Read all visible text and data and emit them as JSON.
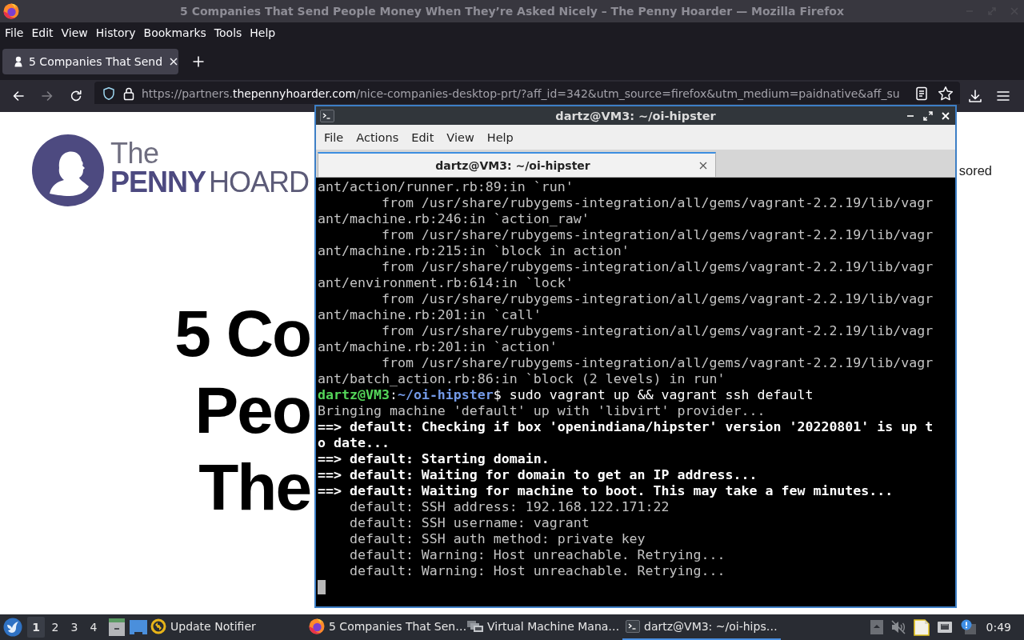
{
  "browser": {
    "title": "5 Companies That Send People Money When They’re Asked Nicely – The Penny Hoarder — Mozilla Firefox",
    "menu": [
      "File",
      "Edit",
      "View",
      "History",
      "Bookmarks",
      "Tools",
      "Help"
    ],
    "tabs": [
      {
        "label": "5 Companies That Send",
        "selected": true
      }
    ],
    "nav_buttons": [
      {
        "kind": "back",
        "disabled": false
      },
      {
        "kind": "forward",
        "disabled": true
      },
      {
        "kind": "reload",
        "disabled": false
      }
    ],
    "url": {
      "prefix": "https://partners.",
      "domain": "thepennyhoarder.com",
      "path": "/nice-companies-desktop-prt/?aff_id=342&utm_source=firefox&utm_medium=paidnative&aff_su"
    }
  },
  "page": {
    "logo": {
      "top": "The",
      "bold": "PENNY",
      "light": "HOARD"
    },
    "sponsor_label": "sored",
    "headline_lines": [
      "5 Co",
      "Peo",
      "The"
    ]
  },
  "terminal": {
    "title": "dartz@VM3: ~/oi-hipster",
    "menu": [
      "File",
      "Actions",
      "Edit",
      "View",
      "Help"
    ],
    "tabs": [
      {
        "label": "dartz@VM3: ~/oi-hipster",
        "selected": true
      }
    ],
    "lines": [
      {
        "kind": "output",
        "text": "ant/action/runner.rb:89:in `run'"
      },
      {
        "kind": "output",
        "text": "        from /usr/share/rubygems-integration/all/gems/vagrant-2.2.19/lib/vagr"
      },
      {
        "kind": "output",
        "text": "ant/machine.rb:246:in `action_raw'"
      },
      {
        "kind": "output",
        "text": "        from /usr/share/rubygems-integration/all/gems/vagrant-2.2.19/lib/vagr"
      },
      {
        "kind": "output",
        "text": "ant/machine.rb:215:in `block in action'"
      },
      {
        "kind": "output",
        "text": "        from /usr/share/rubygems-integration/all/gems/vagrant-2.2.19/lib/vagr"
      },
      {
        "kind": "output",
        "text": "ant/environment.rb:614:in `lock'"
      },
      {
        "kind": "output",
        "text": "        from /usr/share/rubygems-integration/all/gems/vagrant-2.2.19/lib/vagr"
      },
      {
        "kind": "output",
        "text": "ant/machine.rb:201:in `call'"
      },
      {
        "kind": "output",
        "text": "        from /usr/share/rubygems-integration/all/gems/vagrant-2.2.19/lib/vagr"
      },
      {
        "kind": "output",
        "text": "ant/machine.rb:201:in `action'"
      },
      {
        "kind": "output",
        "text": "        from /usr/share/rubygems-integration/all/gems/vagrant-2.2.19/lib/vagr"
      },
      {
        "kind": "output",
        "text": "ant/batch_action.rb:86:in `block (2 levels) in run'"
      },
      {
        "kind": "prompt",
        "user": "dartz@VM3",
        "separator": ":",
        "path": "~/oi-hipster",
        "command": "$ sudo vagrant up && vagrant ssh default"
      },
      {
        "kind": "output",
        "text": "Bringing machine 'default' up with 'libvirt' provider..."
      },
      {
        "kind": "status",
        "text": "==> default: Checking if box 'openindiana/hipster' version '20220801' is up t"
      },
      {
        "kind": "status",
        "text": "o date..."
      },
      {
        "kind": "status",
        "text": "==> default: Starting domain."
      },
      {
        "kind": "status",
        "text": "==> default: Waiting for domain to get an IP address..."
      },
      {
        "kind": "status",
        "text": "==> default: Waiting for machine to boot. This may take a few minutes..."
      },
      {
        "kind": "output",
        "text": "    default: SSH address: 192.168.122.171:22"
      },
      {
        "kind": "output",
        "text": "    default: SSH username: vagrant"
      },
      {
        "kind": "output",
        "text": "    default: SSH auth method: private key"
      },
      {
        "kind": "output",
        "text": "    default: Warning: Host unreachable. Retrying..."
      },
      {
        "kind": "output",
        "text": "    default: Warning: Host unreachable. Retrying..."
      },
      {
        "kind": "cursor"
      }
    ]
  },
  "taskbar": {
    "workspaces": [
      {
        "label": "1",
        "selected": true
      },
      {
        "label": "2",
        "selected": false
      },
      {
        "label": "3",
        "selected": false
      },
      {
        "label": "4",
        "selected": false
      }
    ],
    "tasks": [
      {
        "kind": "notifier",
        "label": "Update Notifier",
        "selected": false
      },
      {
        "kind": "browser",
        "label": "5 Companies That Sen…",
        "selected": false
      },
      {
        "kind": "vm",
        "label": "Virtual Machine Mana…",
        "selected": false
      },
      {
        "kind": "terminal",
        "label": "dartz@VM3: ~/oi-hips…",
        "selected": true
      }
    ],
    "clock": "0:49"
  }
}
